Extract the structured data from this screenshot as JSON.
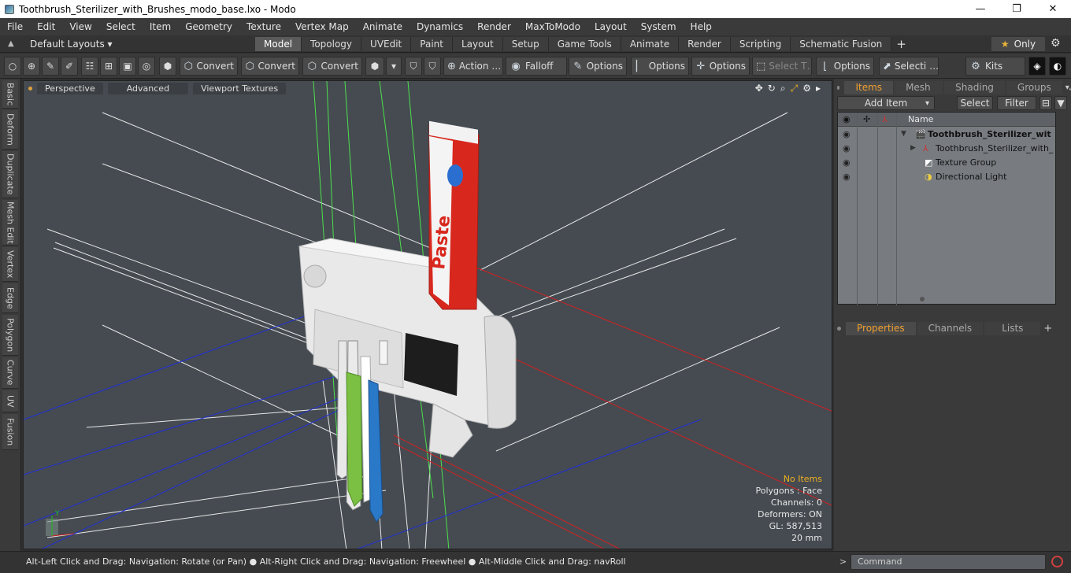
{
  "window": {
    "title": "Toothbrush_Sterilizer_with_Brushes_modo_base.lxo - Modo",
    "minimize": "—",
    "maximize": "❐",
    "close": "✕"
  },
  "menu": [
    "File",
    "Edit",
    "View",
    "Select",
    "Item",
    "Geometry",
    "Texture",
    "Vertex Map",
    "Animate",
    "Dynamics",
    "Render",
    "MaxToModo",
    "Layout",
    "System",
    "Help"
  ],
  "layout_bar": {
    "default_layouts": "Default Layouts ▾",
    "tabs": [
      "Model",
      "Topology",
      "UVEdit",
      "Paint",
      "Layout",
      "Setup",
      "Game Tools",
      "Animate",
      "Render",
      "Scripting",
      "Schematic Fusion"
    ],
    "active_tab": "Model",
    "add": "+",
    "only": "Only"
  },
  "toolbar": {
    "convert1": "Convert",
    "convert2": "Convert",
    "convert3": "Convert",
    "action": "Action …",
    "falloff": "Falloff",
    "options1": "Options",
    "options2": "Options",
    "options3": "Options",
    "select_t": "Select T…",
    "options4": "Options",
    "selecti": "Selecti …",
    "kits": "Kits"
  },
  "left_tabs": [
    "Basic",
    "Deform",
    "Duplicate",
    "Mesh Edit",
    "Vertex",
    "Edge",
    "Polygon",
    "Curve",
    "UV",
    "Fusion"
  ],
  "viewport": {
    "tabs": [
      "Perspective",
      "Advanced",
      "Viewport Textures"
    ],
    "stats": {
      "no_items": "No Items",
      "polygons": "Polygons : Face",
      "channels": "Channels: 0",
      "deformers": "Deformers: ON",
      "gl": "GL: 587,513",
      "size": "20 mm"
    },
    "axis_y": "Y",
    "tube_text": "Paste"
  },
  "items_panel": {
    "tabs": [
      "Items",
      "Mesh …",
      "Shading",
      "Groups"
    ],
    "active_tab": "Items",
    "add_item": "Add Item",
    "select": "Select",
    "filter": "Filter",
    "col_name": "Name",
    "rows": [
      {
        "label": "Toothbrush_Sterilizer_wit …",
        "bold": true
      },
      {
        "label": "Toothbrush_Sterilizer_with_ …",
        "bold": false
      },
      {
        "label": "Texture Group",
        "bold": false
      },
      {
        "label": "Directional Light",
        "bold": false
      }
    ]
  },
  "props_panel": {
    "tabs": [
      "Properties",
      "Channels",
      "Lists"
    ],
    "active_tab": "Properties",
    "add": "+"
  },
  "statusbar": {
    "hint": "Alt-Left Click and Drag: Navigation: Rotate (or Pan) ● Alt-Right Click and Drag: Navigation: Freewheel ● Alt-Middle Click and Drag: navRoll",
    "command_placeholder": "Command"
  },
  "colors": {
    "accent_orange": "#f0a030",
    "viewport_bg": "#454b51",
    "toothbrush_green": "#7bc043",
    "toothbrush_blue": "#2a78c8",
    "tube_red": "#d8281e"
  }
}
